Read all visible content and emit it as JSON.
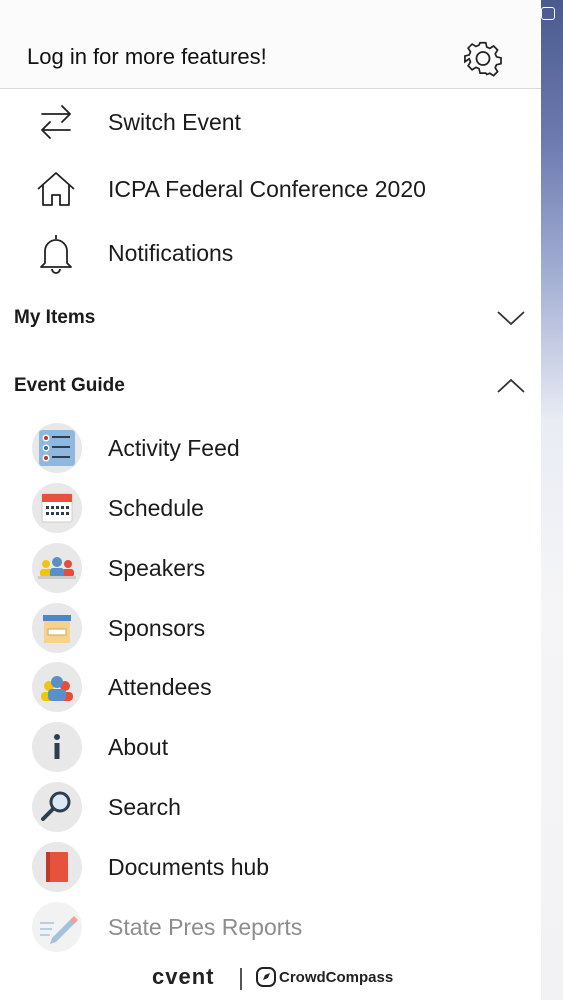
{
  "header": {
    "login_prompt": "Log in for more features!",
    "settings_icon": "gear-icon"
  },
  "menu": {
    "switch_event": "Switch Event",
    "event_home": "ICPA Federal Conference 2020",
    "notifications": "Notifications"
  },
  "sections": {
    "my_items": "My Items",
    "event_guide": "Event Guide"
  },
  "guide_items": [
    {
      "label": "Activity Feed",
      "icon": "activity-feed-icon"
    },
    {
      "label": "Schedule",
      "icon": "calendar-icon"
    },
    {
      "label": "Speakers",
      "icon": "speakers-icon"
    },
    {
      "label": "Sponsors",
      "icon": "storefront-icon"
    },
    {
      "label": "Attendees",
      "icon": "attendees-icon"
    },
    {
      "label": "About",
      "icon": "info-icon"
    },
    {
      "label": "Search",
      "icon": "magnifier-icon"
    },
    {
      "label": "Documents hub",
      "icon": "book-icon"
    },
    {
      "label": "State Pres Reports",
      "icon": "pencil-icon"
    }
  ],
  "footer": {
    "brand": "cvent",
    "partner": "CrowdCompass"
  }
}
